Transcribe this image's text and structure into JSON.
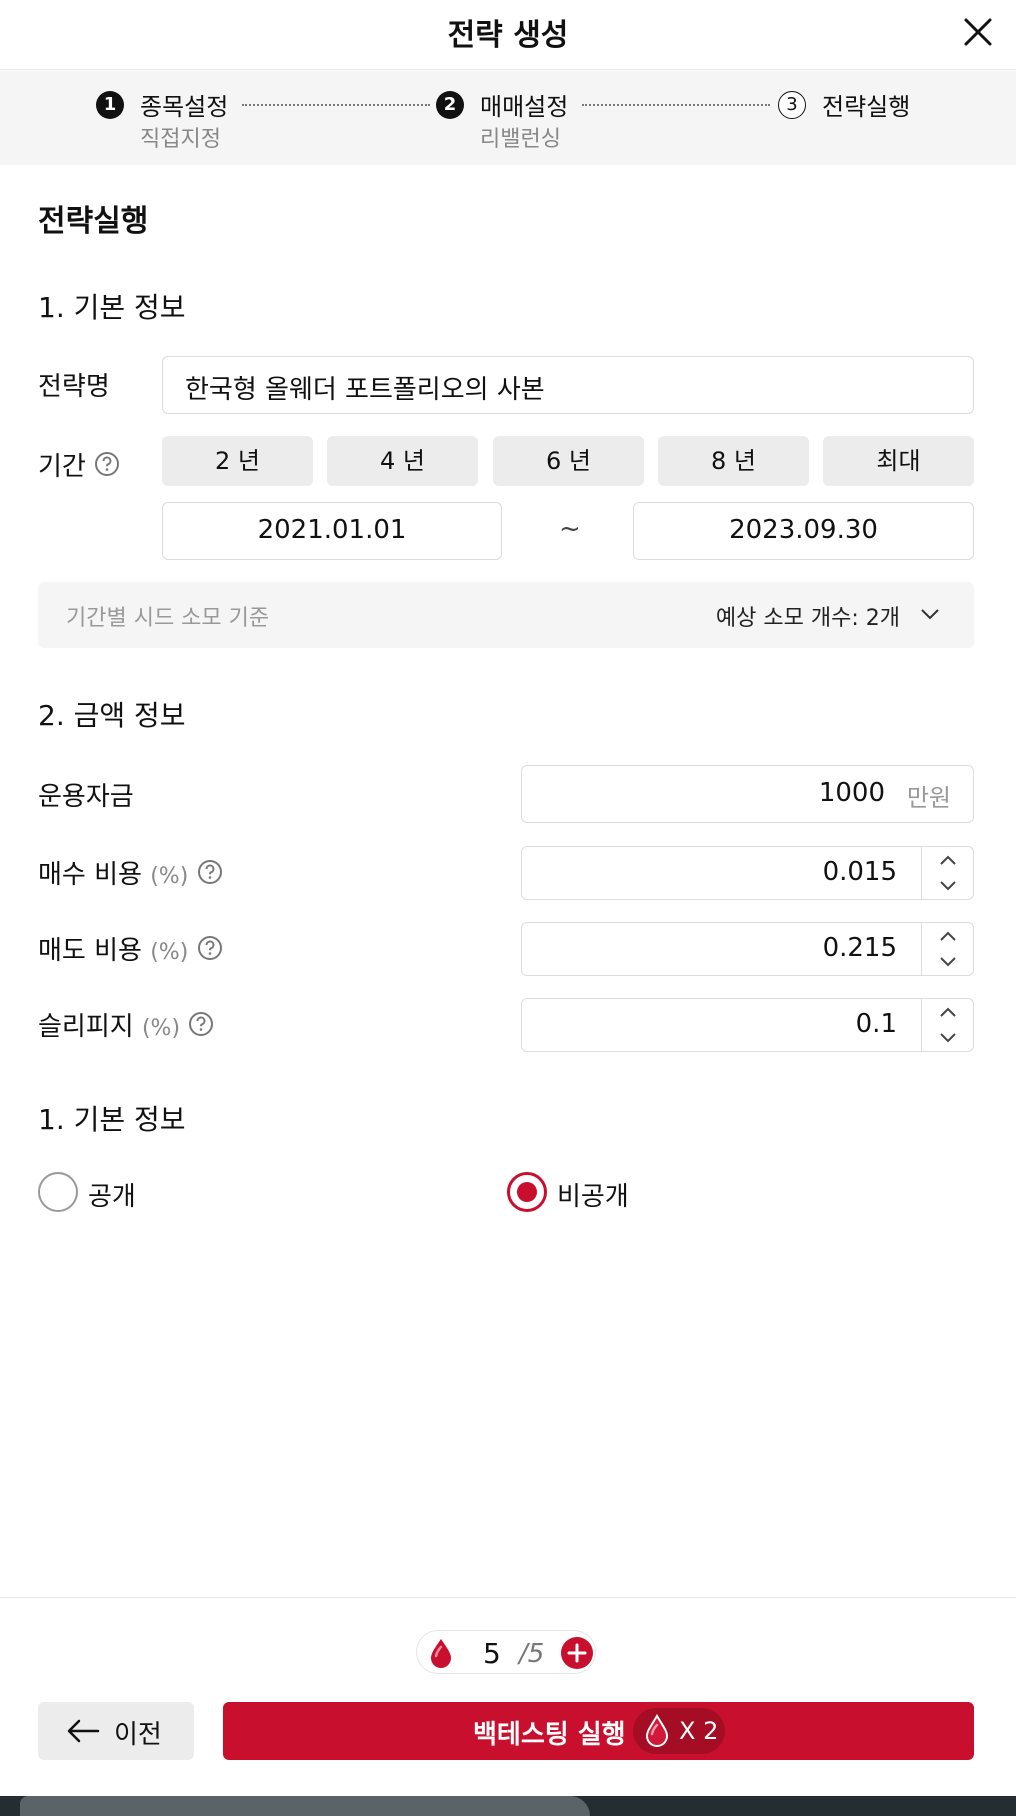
{
  "header": {
    "title": "전략 생성"
  },
  "stepper": {
    "steps": [
      {
        "num": "1",
        "label": "종목설정",
        "sub": "직접지정"
      },
      {
        "num": "2",
        "label": "매매설정",
        "sub": "리밸런싱"
      },
      {
        "num": "3",
        "label": "전략실행",
        "sub": ""
      }
    ]
  },
  "page": {
    "title": "전략실행"
  },
  "basic": {
    "heading": "1. 기본 정보",
    "name_label": "전략명",
    "name_value": "한국형 올웨더 포트폴리오의 사본",
    "period_label": "기간",
    "period_options": [
      "2 년",
      "4 년",
      "6 년",
      "8 년",
      "최대"
    ],
    "start_date": "2021.01.01",
    "tilde": "~",
    "end_date": "2023.09.30",
    "seed_label": "기간별 시드 소모 기준",
    "seed_estimate": "예상 소모 개수: 2개"
  },
  "amount": {
    "heading": "2. 금액 정보",
    "capital_label": "운용자금",
    "capital_value": "1000",
    "capital_unit": "만원",
    "buy_label": "매수 비용",
    "buy_value": "0.015",
    "sell_label": "매도 비용",
    "sell_value": "0.215",
    "slip_label": "슬리피지",
    "slip_value": "0.1",
    "percent_unit": "(%)"
  },
  "visibility": {
    "heading": "1. 기본 정보",
    "options": [
      "공개",
      "비공개"
    ],
    "selected": "비공개"
  },
  "footer": {
    "seed_count": "5",
    "seed_total": "/5",
    "prev_label": "이전",
    "run_label": "백테스팅 실행",
    "run_cost": "X 2"
  },
  "colors": {
    "accent": "#c8102e"
  }
}
